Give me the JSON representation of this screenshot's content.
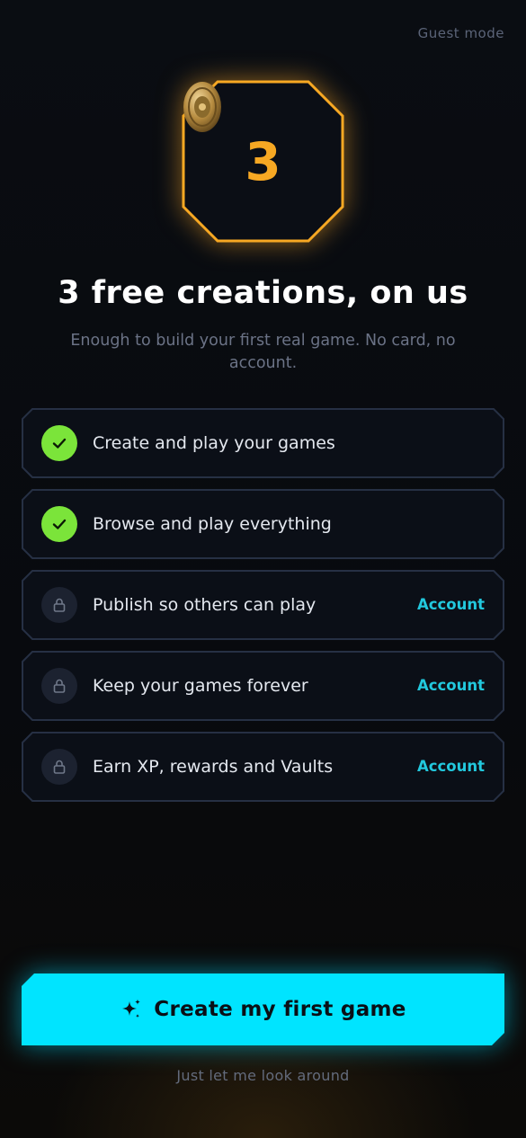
{
  "header": {
    "guest_mode_label": "Guest mode"
  },
  "credits_badge": {
    "coin_icon": "coin-icon",
    "count": "3",
    "accent_color": "#f7a823"
  },
  "headline": "3 free creations, on us",
  "subtext": "Enough to build your first real game. No card, no account.",
  "features": [
    {
      "label": "Create and play your games",
      "status": "included",
      "icon": "check-icon",
      "tag": ""
    },
    {
      "label": "Browse and play everything",
      "status": "included",
      "icon": "check-icon",
      "tag": ""
    },
    {
      "label": "Publish so others can play",
      "status": "locked",
      "icon": "lock-icon",
      "tag": "Account"
    },
    {
      "label": "Keep your games forever",
      "status": "locked",
      "icon": "lock-icon",
      "tag": "Account"
    },
    {
      "label": "Earn XP, rewards and Vaults",
      "status": "locked",
      "icon": "lock-icon",
      "tag": "Account"
    }
  ],
  "cta": {
    "label": "Create my first game",
    "icon": "sparkle-icon",
    "color": "#00e4ff"
  },
  "secondary_link": "Just let me look around",
  "colors": {
    "check_green": "#7be43a",
    "tag_cyan": "#22c8dd",
    "background": "#06080c"
  }
}
